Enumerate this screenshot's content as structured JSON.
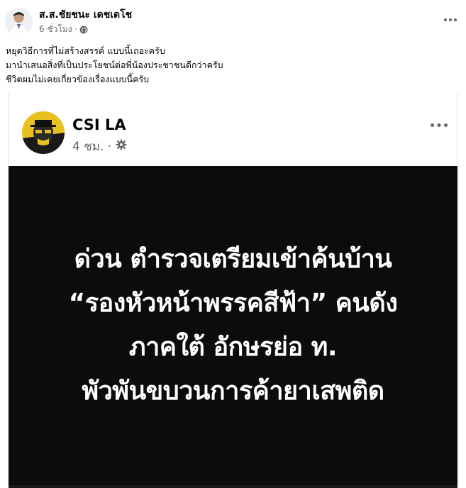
{
  "post": {
    "author": "ส.ส.ชัยชนะ เดชเดโช",
    "time": "6 ชั่วโมง ·",
    "privacy_icon": "globe-icon",
    "caption_lines": [
      "หยุดวิธีการที่ไม่สร้างสรรค์ แบบนี้เถอะครับ",
      "มานำเสนอสิ่งที่เป็นประโยชน์ต่อพี่น้องประชาชนดีกว่าครับ",
      "ชีวิตผมไม่เคยเกี่ยวข้องเรื่องแบบนี้ครับ"
    ]
  },
  "shared": {
    "page_name": "CSI LA",
    "time": "4 ชม. ·",
    "privacy_icon": "gear-icon",
    "headline_lines": [
      "ด่วน ตำรวจเตรียมเข้าค้นบ้าน",
      "“รองหัวหน้าพรรคสีฟ้า” คนดัง",
      "ภาคใต้ อักษรย่อ ท.",
      "พัวพันขบวนการค้ายาเสพติด"
    ]
  },
  "colors": {
    "meta_text": "#65676b",
    "image_background": "#0c0c0c",
    "headline_text": "#ffffff"
  }
}
